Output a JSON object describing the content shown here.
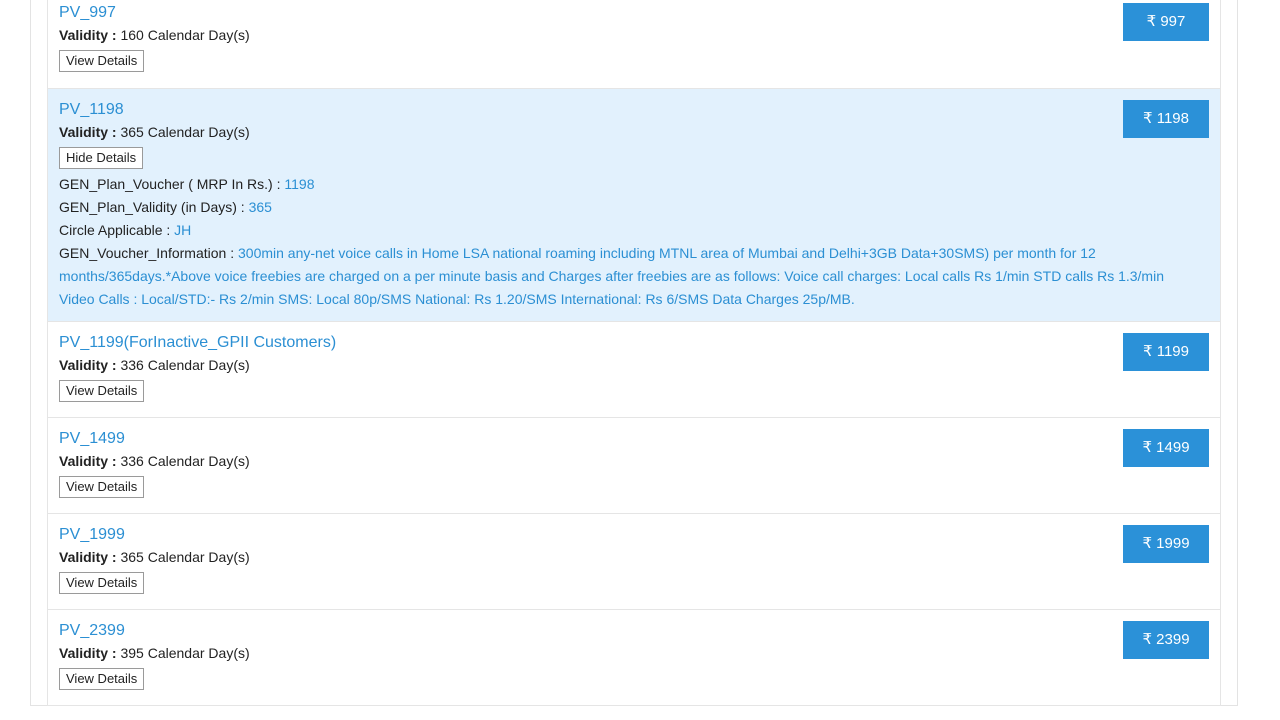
{
  "currency_symbol": "₹",
  "plans": [
    {
      "name": "PV_997",
      "validity_label": "Validity :",
      "validity_value": "160 Calendar Day(s)",
      "details_button": "View Details",
      "price": "997"
    },
    {
      "name": "PV_1198",
      "validity_label": "Validity :",
      "validity_value": "365 Calendar Day(s)",
      "details_button": "Hide Details",
      "price": "1198",
      "details": {
        "mrp_label": "GEN_Plan_Voucher ( MRP In Rs.) :",
        "mrp_value": "1198",
        "validity_days_label": "GEN_Plan_Validity (in Days) :",
        "validity_days_value": "365",
        "circle_label": "Circle Applicable :",
        "circle_value": "JH",
        "info_label": "GEN_Voucher_Information :",
        "info_value": "300min any-net voice calls in Home LSA national roaming including MTNL area of Mumbai and Delhi+3GB Data+30SMS) per month for 12 months/365days.*Above voice freebies are charged on a per minute basis and Charges after freebies are as follows: Voice call charges: Local calls Rs 1/min STD calls Rs 1.3/min Video Calls : Local/STD:- Rs 2/min SMS: Local 80p/SMS National: Rs 1.20/SMS International: Rs 6/SMS Data Charges 25p/MB."
      }
    },
    {
      "name": "PV_1199(ForInactive_GPII Customers)",
      "validity_label": "Validity :",
      "validity_value": "336 Calendar Day(s)",
      "details_button": "View Details",
      "price": "1199"
    },
    {
      "name": "PV_1499",
      "validity_label": "Validity :",
      "validity_value": "336 Calendar Day(s)",
      "details_button": "View Details",
      "price": "1499"
    },
    {
      "name": "PV_1999",
      "validity_label": "Validity :",
      "validity_value": "365 Calendar Day(s)",
      "details_button": "View Details",
      "price": "1999"
    },
    {
      "name": "PV_2399",
      "validity_label": "Validity :",
      "validity_value": "395 Calendar Day(s)",
      "details_button": "View Details",
      "price": "2399"
    }
  ],
  "colors": {
    "link": "#2b8fd3",
    "button": "#2b91d8",
    "expanded_bg": "#e2f1fd"
  }
}
